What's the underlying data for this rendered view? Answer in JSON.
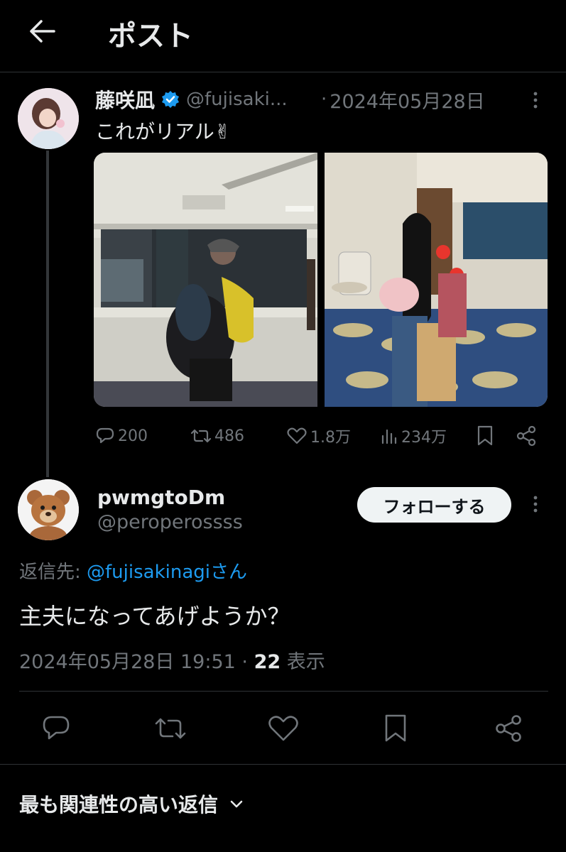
{
  "header": {
    "title": "ポスト"
  },
  "original_post": {
    "display_name": "藤咲凪",
    "handle": "@fujisaki...",
    "separator": "·",
    "date": "2024年05月28日",
    "text": "これがリアル✌",
    "stats": {
      "replies": "200",
      "reposts": "486",
      "likes": "1.8万",
      "views": "234万"
    },
    "photos": [
      "photo-1",
      "photo-2"
    ]
  },
  "reply": {
    "display_name": "pwmgtoDm",
    "handle": "@peroperossss",
    "follow_label": "フォローする",
    "replying_to_prefix": "返信先: ",
    "replying_to_handle": "@fujisakinagi",
    "replying_to_suffix": "さん",
    "text": "主夫になってあげようか？",
    "timestamp": "2024年05月28日 19:51",
    "dot": "·",
    "view_count": "22",
    "view_label": "表示"
  },
  "sort": {
    "label": "最も関連性の高い返信"
  },
  "colors": {
    "background": "#000000",
    "accent": "#1d9bf0",
    "muted": "#71767b",
    "text": "#e7e9ea",
    "verified": "#1d9bf0"
  }
}
